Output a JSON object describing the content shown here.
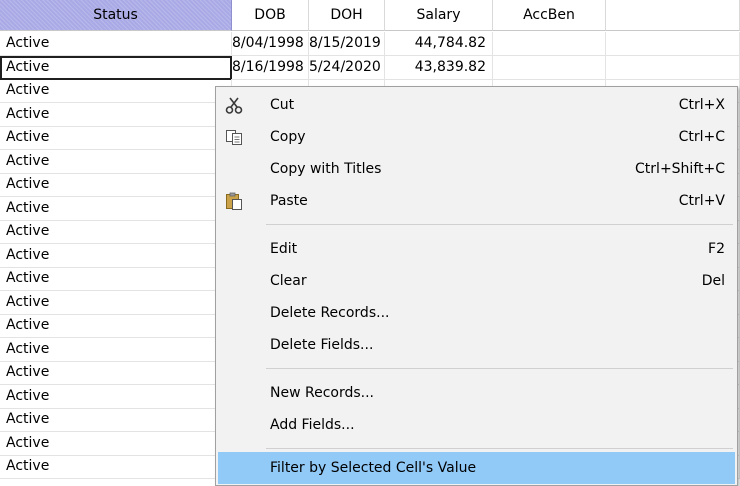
{
  "columns": [
    "Status",
    "DOB",
    "DOH",
    "Salary",
    "AccBen"
  ],
  "rows": [
    {
      "status": "Active",
      "dob": "8/04/1998",
      "doh": "8/15/2019",
      "salary": "44,784.82",
      "accben": ""
    },
    {
      "status": "Active",
      "dob": "8/16/1998",
      "doh": "5/24/2020",
      "salary": "43,839.82",
      "accben": ""
    },
    {
      "status": "Active",
      "dob": "",
      "doh": "",
      "salary": "",
      "accben": ""
    },
    {
      "status": "Active",
      "dob": "",
      "doh": "",
      "salary": "",
      "accben": ""
    },
    {
      "status": "Active",
      "dob": "",
      "doh": "",
      "salary": "",
      "accben": ""
    },
    {
      "status": "Active",
      "dob": "",
      "doh": "",
      "salary": "",
      "accben": ""
    },
    {
      "status": "Active",
      "dob": "",
      "doh": "",
      "salary": "",
      "accben": ""
    },
    {
      "status": "Active",
      "dob": "",
      "doh": "",
      "salary": "",
      "accben": ""
    },
    {
      "status": "Active",
      "dob": "",
      "doh": "",
      "salary": "",
      "accben": ""
    },
    {
      "status": "Active",
      "dob": "",
      "doh": "",
      "salary": "",
      "accben": ""
    },
    {
      "status": "Active",
      "dob": "",
      "doh": "",
      "salary": "",
      "accben": ""
    },
    {
      "status": "Active",
      "dob": "",
      "doh": "",
      "salary": "",
      "accben": ""
    },
    {
      "status": "Active",
      "dob": "",
      "doh": "",
      "salary": "",
      "accben": ""
    },
    {
      "status": "Active",
      "dob": "",
      "doh": "",
      "salary": "",
      "accben": ""
    },
    {
      "status": "Active",
      "dob": "",
      "doh": "",
      "salary": "",
      "accben": ""
    },
    {
      "status": "Active",
      "dob": "",
      "doh": "",
      "salary": "",
      "accben": ""
    },
    {
      "status": "Active",
      "dob": "",
      "doh": "",
      "salary": "",
      "accben": ""
    },
    {
      "status": "Active",
      "dob": "",
      "doh": "",
      "salary": "",
      "accben": ""
    },
    {
      "status": "Active",
      "dob": "",
      "doh": "",
      "salary": "",
      "accben": ""
    }
  ],
  "context_menu": {
    "items": [
      {
        "label": "Cut",
        "shortcut": "Ctrl+X",
        "icon": "scissors-icon"
      },
      {
        "label": "Copy",
        "shortcut": "Ctrl+C",
        "icon": "copy-icon"
      },
      {
        "label": "Copy with Titles",
        "shortcut": "Ctrl+Shift+C",
        "icon": ""
      },
      {
        "label": "Paste",
        "shortcut": "Ctrl+V",
        "icon": "paste-icon"
      },
      {
        "label": "Edit",
        "shortcut": "F2",
        "icon": ""
      },
      {
        "label": "Clear",
        "shortcut": "Del",
        "icon": ""
      },
      {
        "label": "Delete Records...",
        "shortcut": "",
        "icon": ""
      },
      {
        "label": "Delete Fields...",
        "shortcut": "",
        "icon": ""
      },
      {
        "label": "New Records...",
        "shortcut": "",
        "icon": ""
      },
      {
        "label": "Add Fields...",
        "shortcut": "",
        "icon": ""
      },
      {
        "label": "Filter by Selected Cell's Value",
        "shortcut": "",
        "icon": ""
      }
    ],
    "highlight_color": "#91c9f7"
  },
  "colors": {
    "selected_header": "#a9a9e6",
    "grid_line": "#e3e3e3"
  }
}
